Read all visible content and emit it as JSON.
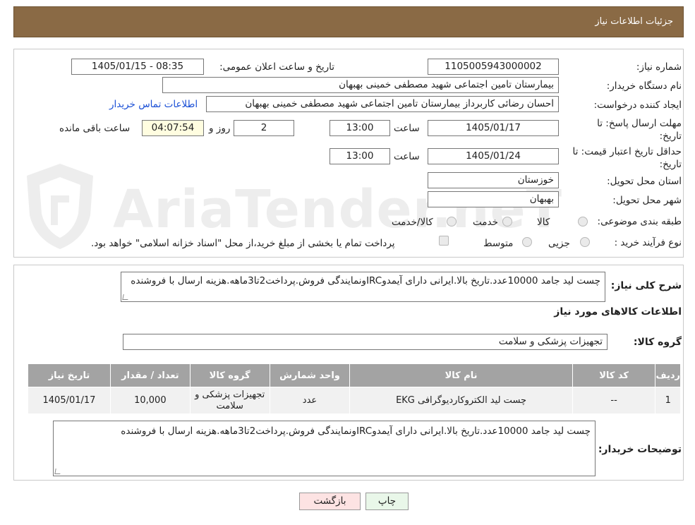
{
  "header": {
    "title": "جزئیات اطلاعات نیاز"
  },
  "fields": {
    "need_number_label": "شماره نیاز:",
    "need_number": "1105005943000002",
    "announce_label": "تاریخ و ساعت اعلان عمومی:",
    "announce_value": "1405/01/15 - 08:35",
    "buyer_org_label": "نام دستگاه خریدار:",
    "buyer_org": "بیمارستان تامین اجتماعی شهید مصطفی خمینی بهبهان",
    "requester_label": "ایجاد کننده درخواست:",
    "requester": "احسان رضائی کاربرداز بیمارستان تامین اجتماعی شهید مصطفی خمینی بهبهان",
    "contact_link": "اطلاعات تماس خریدار",
    "deadline_label": "مهلت ارسال پاسخ: تا تاریخ:",
    "deadline_date": "1405/01/17",
    "time_label": "ساعت",
    "deadline_time": "13:00",
    "days_value": "2",
    "days_label": "روز و",
    "remaining_time": "04:07:54",
    "remaining_label": "ساعت باقی مانده",
    "validity_label": "حداقل تاریخ اعتبار قیمت: تا تاریخ:",
    "validity_date": "1405/01/24",
    "validity_time": "13:00",
    "province_label": "استان محل تحویل:",
    "province": "خوزستان",
    "city_label": "شهر محل تحویل:",
    "city": "بهبهان",
    "category_label": "طبقه بندی موضوعی:",
    "category_options": [
      "کالا",
      "خدمت",
      "کالا/خدمت"
    ],
    "process_label": "نوع فرآیند خرید :",
    "process_options": [
      "جزیی",
      "متوسط"
    ],
    "payment_note": "پرداخت تمام یا بخشی از مبلغ خرید،از محل \"اسناد خزانه اسلامی\" خواهد بود."
  },
  "description": {
    "label": "شرح کلی نیاز:",
    "text": "چست لید جامد 10000عدد.تاریخ بالا.ایرانی دارای آیمدوIRCونمایندگی فروش.پرداخت2تا3ماهه.هزینه ارسال با فروشنده"
  },
  "goods": {
    "section_title": "اطلاعات کالاهای مورد نیاز",
    "group_label": "گروه کالا:",
    "group_value": "تجهیزات پزشکی و سلامت"
  },
  "table": {
    "headers": [
      "ردیف",
      "کد کالا",
      "نام کالا",
      "واحد شمارش",
      "گروه کالا",
      "تعداد / مقدار",
      "تاریخ نیاز"
    ],
    "rows": [
      [
        "1",
        "--",
        "چست لید الکتروکاردیوگرافی EKG",
        "عدد",
        "تجهیزات پزشکی و سلامت",
        "10,000",
        "1405/01/17"
      ]
    ]
  },
  "buyer_notes": {
    "label": "توضیحات خریدار:",
    "text": "چست لید جامد 10000عدد.تاریخ بالا.ایرانی دارای آیمدوIRCونمایندگی فروش.پرداخت2تا3ماهه.هزینه ارسال با فروشنده"
  },
  "buttons": {
    "print": "چاپ",
    "back": "بازگشت"
  },
  "watermark": {
    "text": "AriaTender.neT"
  },
  "colors": {
    "header": "#8a6a45",
    "table_header": "#a3a3a3",
    "link": "#1a4fd6"
  }
}
